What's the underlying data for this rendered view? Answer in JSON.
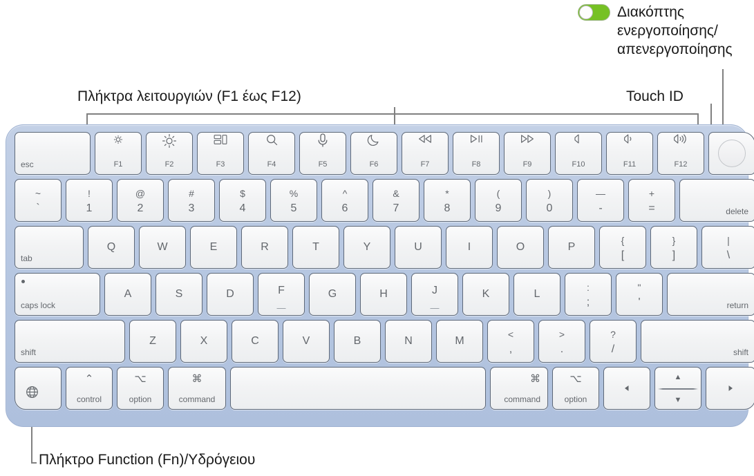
{
  "callouts": {
    "power_toggle": "Διακόπτης\nενεργοποίησης/\nαπενεργοποίησης",
    "function_keys": "Πλήκτρα λειτουργιών (F1 έως F12)",
    "touch_id": "Touch ID",
    "fn_globe": "Πλήκτρο Function (Fn)/Υδρόγειου"
  },
  "colors": {
    "toggle_on": "#76c124",
    "keyboard_body": "#b8c8e2",
    "key_face": "#f2f3f4",
    "legend": "#63676c",
    "leader_line": "#808080"
  },
  "toggle": {
    "state": "on",
    "knob_position": "left"
  },
  "keyboard": {
    "function_row": [
      {
        "name": "esc",
        "label": "esc",
        "style": "word-bl",
        "width": 112
      },
      {
        "name": "f1",
        "icon": "brightness-down-icon",
        "fn": "F1"
      },
      {
        "name": "f2",
        "icon": "brightness-up-icon",
        "fn": "F2"
      },
      {
        "name": "f3",
        "icon": "mission-control-icon",
        "fn": "F3"
      },
      {
        "name": "f4",
        "icon": "spotlight-search-icon",
        "fn": "F4"
      },
      {
        "name": "f5",
        "icon": "dictation-mic-icon",
        "fn": "F5"
      },
      {
        "name": "f6",
        "icon": "do-not-disturb-moon-icon",
        "fn": "F6"
      },
      {
        "name": "f7",
        "icon": "rewind-icon",
        "fn": "F7"
      },
      {
        "name": "f8",
        "icon": "play-pause-icon",
        "fn": "F8"
      },
      {
        "name": "f9",
        "icon": "fast-forward-icon",
        "fn": "F9"
      },
      {
        "name": "f10",
        "icon": "mute-icon",
        "fn": "F10"
      },
      {
        "name": "f11",
        "icon": "volume-down-icon",
        "fn": "F11"
      },
      {
        "name": "f12",
        "icon": "volume-up-icon",
        "fn": "F12"
      },
      {
        "name": "touch-id",
        "icon": "touch-id-icon"
      }
    ],
    "number_row": [
      {
        "name": "backtick",
        "top": "~",
        "bottom": "`"
      },
      {
        "name": "one",
        "top": "!",
        "bottom": "1"
      },
      {
        "name": "two",
        "top": "@",
        "bottom": "2"
      },
      {
        "name": "three",
        "top": "#",
        "bottom": "3"
      },
      {
        "name": "four",
        "top": "$",
        "bottom": "4"
      },
      {
        "name": "five",
        "top": "%",
        "bottom": "5"
      },
      {
        "name": "six",
        "top": "^",
        "bottom": "6"
      },
      {
        "name": "seven",
        "top": "&",
        "bottom": "7"
      },
      {
        "name": "eight",
        "top": "*",
        "bottom": "8"
      },
      {
        "name": "nine",
        "top": "(",
        "bottom": "9"
      },
      {
        "name": "zero",
        "top": ")",
        "bottom": "0"
      },
      {
        "name": "minus",
        "top": "—",
        "bottom": "-"
      },
      {
        "name": "equals",
        "top": "+",
        "bottom": "="
      },
      {
        "name": "delete",
        "label": "delete",
        "style": "word-br"
      }
    ],
    "top_letter_row": [
      {
        "name": "tab",
        "label": "tab",
        "style": "word-bl"
      },
      {
        "name": "q",
        "label": "Q"
      },
      {
        "name": "w",
        "label": "W"
      },
      {
        "name": "e",
        "label": "E"
      },
      {
        "name": "r",
        "label": "R"
      },
      {
        "name": "t",
        "label": "T"
      },
      {
        "name": "y",
        "label": "Y"
      },
      {
        "name": "u",
        "label": "U"
      },
      {
        "name": "i",
        "label": "I"
      },
      {
        "name": "o",
        "label": "O"
      },
      {
        "name": "p",
        "label": "P"
      },
      {
        "name": "left-bracket",
        "top": "{",
        "bottom": "["
      },
      {
        "name": "right-bracket",
        "top": "}",
        "bottom": "]"
      },
      {
        "name": "backslash",
        "top": "|",
        "bottom": "\\"
      }
    ],
    "home_row": [
      {
        "name": "caps-lock",
        "label": "caps lock",
        "style": "word-bl",
        "indicator": true
      },
      {
        "name": "a",
        "label": "A"
      },
      {
        "name": "s",
        "label": "S"
      },
      {
        "name": "d",
        "label": "D"
      },
      {
        "name": "f",
        "label": "F",
        "bump": true
      },
      {
        "name": "g",
        "label": "G"
      },
      {
        "name": "h",
        "label": "H"
      },
      {
        "name": "j",
        "label": "J",
        "bump": true
      },
      {
        "name": "k",
        "label": "K"
      },
      {
        "name": "l",
        "label": "L"
      },
      {
        "name": "semicolon",
        "top": ":",
        "bottom": ";"
      },
      {
        "name": "quote",
        "top": "\"",
        "bottom": "'"
      },
      {
        "name": "return",
        "label": "return",
        "style": "word-br"
      }
    ],
    "shift_row": [
      {
        "name": "shift-left",
        "label": "shift",
        "style": "word-bl"
      },
      {
        "name": "z",
        "label": "Z"
      },
      {
        "name": "x",
        "label": "X"
      },
      {
        "name": "c",
        "label": "C"
      },
      {
        "name": "v",
        "label": "V"
      },
      {
        "name": "b",
        "label": "B"
      },
      {
        "name": "n",
        "label": "N"
      },
      {
        "name": "m",
        "label": "M"
      },
      {
        "name": "comma",
        "top": "<",
        "bottom": ","
      },
      {
        "name": "period",
        "top": ">",
        "bottom": "."
      },
      {
        "name": "slash",
        "top": "?",
        "bottom": "/"
      },
      {
        "name": "shift-right",
        "label": "shift",
        "style": "word-br"
      }
    ],
    "bottom_row": [
      {
        "name": "fn-globe",
        "icon": "globe-icon"
      },
      {
        "name": "control",
        "symbol": "⌃",
        "label": "control"
      },
      {
        "name": "option-left",
        "symbol": "⌥",
        "label": "option"
      },
      {
        "name": "command-left",
        "symbol": "⌘",
        "label": "command"
      },
      {
        "name": "space",
        "label": ""
      },
      {
        "name": "command-right",
        "symbol": "⌘",
        "label": "command",
        "align": "right"
      },
      {
        "name": "option-right",
        "symbol": "⌥",
        "label": "option",
        "align": "right"
      },
      {
        "name": "arrow-left",
        "icon": "arrow-left-icon"
      },
      {
        "name": "arrow-up-down",
        "icon": "arrow-up-down-icon",
        "up": "▲",
        "down": "▼"
      },
      {
        "name": "arrow-right",
        "icon": "arrow-right-icon"
      }
    ]
  }
}
